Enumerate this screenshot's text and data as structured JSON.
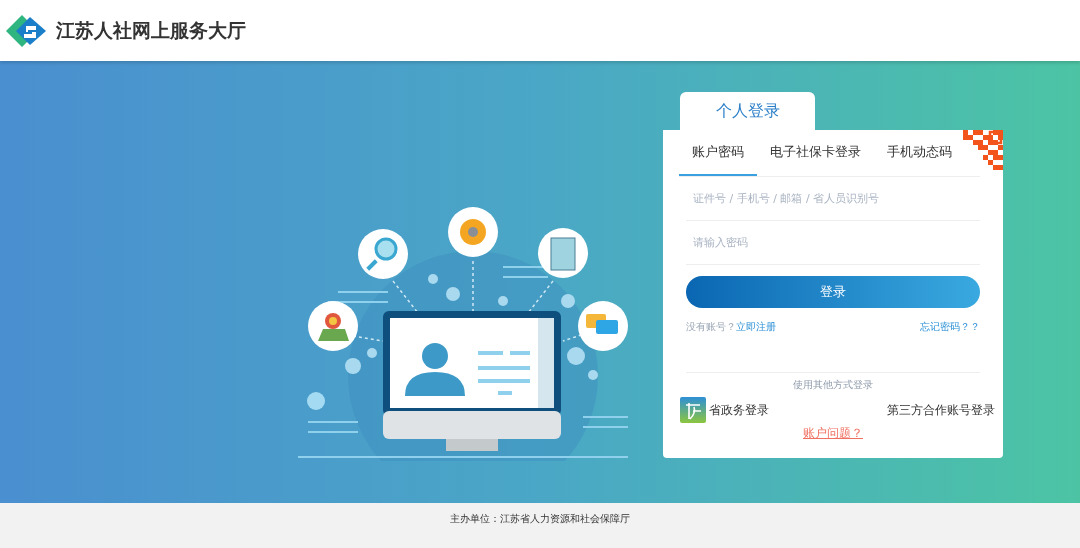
{
  "header": {
    "title": "江苏人社网上服务大厅"
  },
  "login": {
    "panel_tab": "个人登录",
    "tabs": [
      {
        "label": "账户密码",
        "selected": true
      },
      {
        "label": "电子社保卡登录",
        "selected": false
      },
      {
        "label": "手机动态码",
        "selected": false
      }
    ],
    "fields": [
      {
        "placeholder": "证件号 / 手机号 / 邮箱 / 省人员识别号"
      },
      {
        "placeholder": "请输入密码"
      }
    ],
    "submit": "登录",
    "register_prompt": "没有账号？",
    "register_link": "立即注册",
    "forgot_link": "忘记密码？？",
    "other_methods": "使用其他方式登录",
    "gov_login": "省政务登录",
    "third_party_login": "第三方合作账号登录",
    "problem_link": "账户问题？"
  },
  "footer": {
    "text": "主办单位：江苏省人力资源和社会保障厅"
  }
}
